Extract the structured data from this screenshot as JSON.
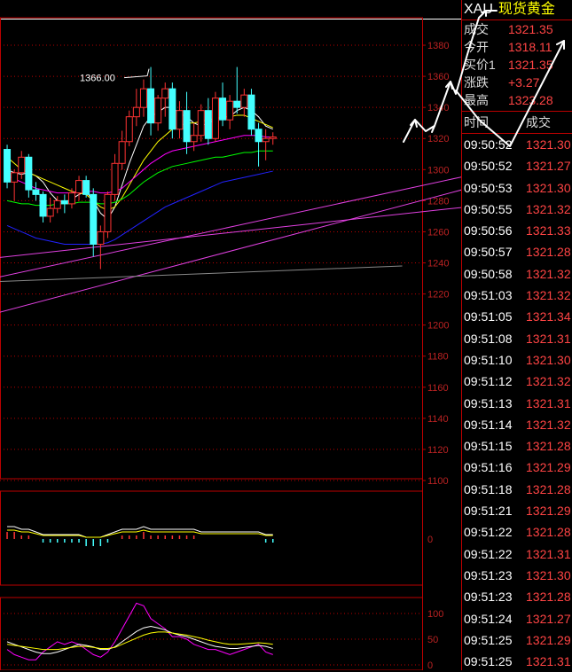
{
  "chart_data": [
    {
      "type": "candlestick",
      "title": "",
      "ylim": [
        1100,
        1392
      ],
      "yticks": [
        1100,
        1120,
        1140,
        1160,
        1180,
        1200,
        1220,
        1240,
        1260,
        1280,
        1300,
        1320,
        1340,
        1360,
        1380
      ],
      "annotation": "1366.00",
      "candles": [
        {
          "o": 1313,
          "h": 1316,
          "l": 1288,
          "c": 1292
        },
        {
          "o": 1292,
          "h": 1300,
          "l": 1280,
          "c": 1298
        },
        {
          "o": 1298,
          "h": 1312,
          "l": 1294,
          "c": 1308
        },
        {
          "o": 1308,
          "h": 1310,
          "l": 1282,
          "c": 1287
        },
        {
          "o": 1287,
          "h": 1292,
          "l": 1280,
          "c": 1284
        },
        {
          "o": 1284,
          "h": 1286,
          "l": 1266,
          "c": 1270
        },
        {
          "o": 1270,
          "h": 1282,
          "l": 1266,
          "c": 1275
        },
        {
          "o": 1275,
          "h": 1283,
          "l": 1272,
          "c": 1280
        },
        {
          "o": 1280,
          "h": 1284,
          "l": 1272,
          "c": 1278
        },
        {
          "o": 1278,
          "h": 1288,
          "l": 1275,
          "c": 1285
        },
        {
          "o": 1285,
          "h": 1296,
          "l": 1280,
          "c": 1293
        },
        {
          "o": 1293,
          "h": 1296,
          "l": 1282,
          "c": 1284
        },
        {
          "o": 1284,
          "h": 1288,
          "l": 1244,
          "c": 1252
        },
        {
          "o": 1252,
          "h": 1264,
          "l": 1236,
          "c": 1260
        },
        {
          "o": 1260,
          "h": 1286,
          "l": 1256,
          "c": 1284
        },
        {
          "o": 1284,
          "h": 1310,
          "l": 1280,
          "c": 1304
        },
        {
          "o": 1304,
          "h": 1325,
          "l": 1300,
          "c": 1318
        },
        {
          "o": 1318,
          "h": 1338,
          "l": 1315,
          "c": 1334
        },
        {
          "o": 1334,
          "h": 1352,
          "l": 1328,
          "c": 1340
        },
        {
          "o": 1340,
          "h": 1358,
          "l": 1334,
          "c": 1352
        },
        {
          "o": 1352,
          "h": 1366,
          "l": 1322,
          "c": 1330
        },
        {
          "o": 1330,
          "h": 1348,
          "l": 1325,
          "c": 1346
        },
        {
          "o": 1346,
          "h": 1356,
          "l": 1334,
          "c": 1352
        },
        {
          "o": 1352,
          "h": 1356,
          "l": 1320,
          "c": 1326
        },
        {
          "o": 1326,
          "h": 1344,
          "l": 1320,
          "c": 1338
        },
        {
          "o": 1338,
          "h": 1350,
          "l": 1310,
          "c": 1318
        },
        {
          "o": 1318,
          "h": 1330,
          "l": 1312,
          "c": 1322
        },
        {
          "o": 1322,
          "h": 1342,
          "l": 1318,
          "c": 1338
        },
        {
          "o": 1338,
          "h": 1346,
          "l": 1316,
          "c": 1320
        },
        {
          "o": 1320,
          "h": 1350,
          "l": 1318,
          "c": 1346
        },
        {
          "o": 1346,
          "h": 1356,
          "l": 1328,
          "c": 1332
        },
        {
          "o": 1332,
          "h": 1348,
          "l": 1326,
          "c": 1344
        },
        {
          "o": 1344,
          "h": 1366,
          "l": 1336,
          "c": 1340
        },
        {
          "o": 1340,
          "h": 1352,
          "l": 1334,
          "c": 1348
        },
        {
          "o": 1348,
          "h": 1352,
          "l": 1322,
          "c": 1326
        },
        {
          "o": 1326,
          "h": 1330,
          "l": 1302,
          "c": 1318
        },
        {
          "o": 1318,
          "h": 1326,
          "l": 1306,
          "c": 1320
        },
        {
          "o": 1320,
          "h": 1324,
          "l": 1316,
          "c": 1321
        }
      ],
      "moving_averages": [
        {
          "color": "#ffffff",
          "values": [
            1300,
            1298,
            1297,
            1298,
            1296,
            1292,
            1285,
            1280,
            1279,
            1281,
            1284,
            1286,
            1280,
            1272,
            1268,
            1276,
            1290,
            1304,
            1316,
            1328,
            1334,
            1337,
            1340,
            1340,
            1336,
            1334,
            1330,
            1328,
            1330,
            1332,
            1334,
            1334,
            1338,
            1340,
            1338,
            1334,
            1328,
            1326
          ]
        },
        {
          "color": "#ffff00",
          "values": [
            1308,
            1304,
            1300,
            1298,
            1296,
            1294,
            1292,
            1290,
            1288,
            1286,
            1285,
            1284,
            1280,
            1276,
            1274,
            1276,
            1282,
            1290,
            1298,
            1306,
            1312,
            1318,
            1322,
            1326,
            1328,
            1330,
            1330,
            1331,
            1332,
            1333,
            1334,
            1334,
            1335,
            1335,
            1333,
            1331,
            1329,
            1327
          ]
        },
        {
          "color": "#ff00ff",
          "values": [
            1296,
            1294,
            1292,
            1290,
            1288,
            1287,
            1286,
            1285,
            1285,
            1285,
            1286,
            1286,
            1286,
            1285,
            1285,
            1286,
            1288,
            1292,
            1296,
            1300,
            1304,
            1307,
            1310,
            1312,
            1313,
            1314,
            1315,
            1316,
            1317,
            1318,
            1319,
            1320,
            1321,
            1322,
            1322,
            1322,
            1321,
            1321
          ]
        },
        {
          "color": "#00ff00",
          "values": [
            1280,
            1279,
            1278,
            1278,
            1277,
            1277,
            1277,
            1278,
            1278,
            1278,
            1279,
            1279,
            1279,
            1278,
            1278,
            1279,
            1281,
            1284,
            1288,
            1292,
            1295,
            1298,
            1300,
            1302,
            1303,
            1304,
            1305,
            1306,
            1307,
            1308,
            1308,
            1309,
            1310,
            1311,
            1311,
            1312,
            1312,
            1312
          ]
        },
        {
          "color": "#2222ff",
          "values": [
            1264,
            1262,
            1260,
            1258,
            1256,
            1255,
            1254,
            1253,
            1252,
            1252,
            1252,
            1252,
            1252,
            1252,
            1253,
            1255,
            1258,
            1261,
            1264,
            1267,
            1270,
            1273,
            1276,
            1278,
            1280,
            1282,
            1284,
            1286,
            1288,
            1290,
            1292,
            1293,
            1294,
            1295,
            1296,
            1297,
            1298,
            1299
          ]
        }
      ]
    },
    {
      "type": "bar",
      "title": "",
      "yticks": [
        0
      ],
      "values": [
        2,
        2,
        1,
        1,
        0,
        -1,
        -1,
        -1,
        -1,
        -1,
        -1,
        -2,
        -2,
        -2,
        -1,
        0,
        1,
        1,
        1,
        2,
        1,
        1,
        1,
        1,
        1,
        1,
        1,
        0,
        0,
        0,
        0,
        0,
        0,
        0,
        0,
        0,
        -1,
        -1
      ]
    },
    {
      "type": "line",
      "title": "",
      "yticks": [
        0,
        50,
        100
      ],
      "series": [
        {
          "color": "#ff00ff",
          "values": [
            30,
            20,
            15,
            10,
            10,
            25,
            35,
            45,
            40,
            45,
            40,
            30,
            20,
            15,
            25,
            45,
            70,
            95,
            120,
            115,
            90,
            80,
            70,
            55,
            55,
            50,
            40,
            35,
            30,
            30,
            25,
            20,
            25,
            30,
            35,
            40,
            25,
            20
          ]
        },
        {
          "color": "#ffffff",
          "values": [
            45,
            40,
            35,
            30,
            25,
            22,
            22,
            25,
            30,
            35,
            40,
            38,
            35,
            30,
            30,
            35,
            45,
            55,
            65,
            72,
            75,
            72,
            68,
            62,
            58,
            55,
            50,
            45,
            40,
            36,
            34,
            32,
            32,
            34,
            36,
            38,
            36,
            32
          ]
        },
        {
          "color": "#ffff00",
          "values": [
            40,
            38,
            36,
            34,
            32,
            30,
            30,
            30,
            32,
            34,
            36,
            36,
            34,
            32,
            32,
            34,
            40,
            46,
            52,
            58,
            62,
            64,
            64,
            62,
            60,
            58,
            55,
            52,
            48,
            45,
            42,
            40,
            40,
            41,
            42,
            43,
            42,
            40
          ]
        }
      ]
    }
  ],
  "quote": {
    "symbol": "XAU",
    "name": "现货黄金",
    "rows": [
      {
        "label": "成交",
        "value": "1321.35"
      },
      {
        "label": "今开",
        "value": "1318.11"
      },
      {
        "label": "买价1",
        "value": "1321.35"
      },
      {
        "label": "涨跌",
        "value": "+3.27"
      },
      {
        "label": "最高",
        "value": "1323.28"
      }
    ]
  },
  "trades_header": {
    "time": "时间",
    "price": "成交"
  },
  "trades": [
    {
      "time": "09:50:52",
      "price": "1321.30"
    },
    {
      "time": "09:50:52",
      "price": "1321.27"
    },
    {
      "time": "09:50:53",
      "price": "1321.30"
    },
    {
      "time": "09:50:55",
      "price": "1321.32"
    },
    {
      "time": "09:50:56",
      "price": "1321.33"
    },
    {
      "time": "09:50:57",
      "price": "1321.28"
    },
    {
      "time": "09:50:58",
      "price": "1321.32"
    },
    {
      "time": "09:51:03",
      "price": "1321.32"
    },
    {
      "time": "09:51:05",
      "price": "1321.34"
    },
    {
      "time": "09:51:08",
      "price": "1321.31"
    },
    {
      "time": "09:51:10",
      "price": "1321.30"
    },
    {
      "time": "09:51:12",
      "price": "1321.32"
    },
    {
      "time": "09:51:13",
      "price": "1321.31"
    },
    {
      "time": "09:51:14",
      "price": "1321.32"
    },
    {
      "time": "09:51:15",
      "price": "1321.28"
    },
    {
      "time": "09:51:16",
      "price": "1321.29"
    },
    {
      "time": "09:51:18",
      "price": "1321.28"
    },
    {
      "time": "09:51:21",
      "price": "1321.29"
    },
    {
      "time": "09:51:22",
      "price": "1321.28"
    },
    {
      "time": "09:51:22",
      "price": "1321.31"
    },
    {
      "time": "09:51:23",
      "price": "1321.30"
    },
    {
      "time": "09:51:23",
      "price": "1321.28"
    },
    {
      "time": "09:51:24",
      "price": "1321.27"
    },
    {
      "time": "09:51:25",
      "price": "1321.29"
    },
    {
      "time": "09:51:25",
      "price": "1321.31"
    }
  ]
}
